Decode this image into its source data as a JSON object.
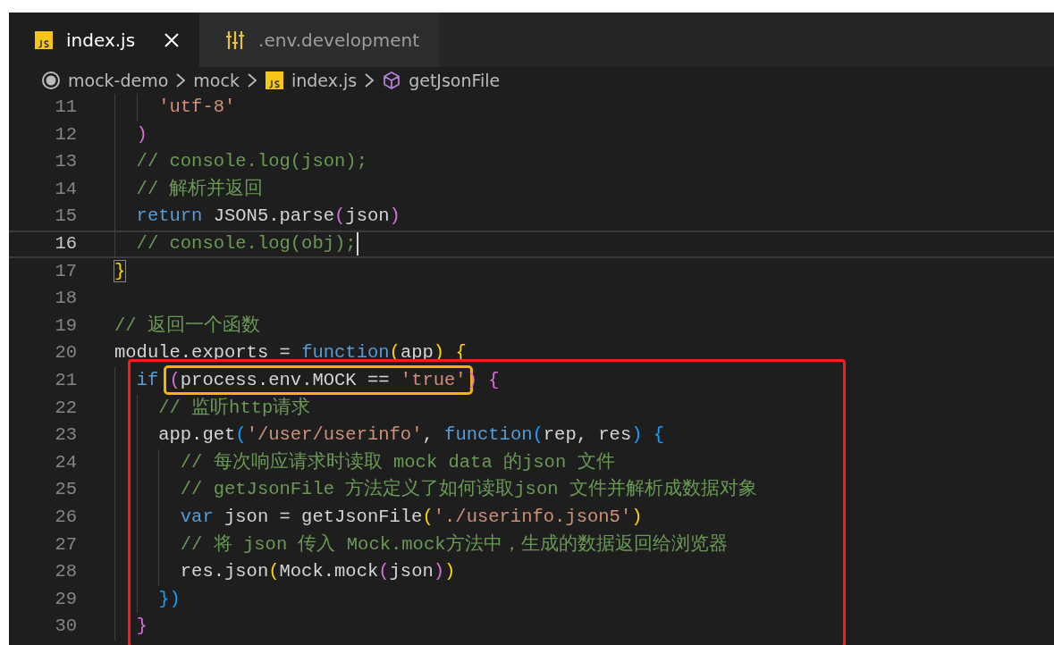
{
  "tabs": [
    {
      "label": "index.js",
      "kind": "script",
      "selected": true,
      "closable": true
    },
    {
      "label": ".env.development",
      "kind": "config",
      "selected": false,
      "closable": false
    }
  ],
  "breadcrumb": [
    {
      "text": "mock-demo",
      "kind": "root"
    },
    {
      "text": "mock",
      "kind": "folder"
    },
    {
      "text": "index.js",
      "kind": "script"
    },
    {
      "text": "getJsonFile",
      "kind": "symbol"
    }
  ],
  "lines": [
    {
      "children": [
        {
          "children": [
            {
              "number": "11",
              "current": false,
              "boxed": false,
              "tokens": [
                {
                  "kind": "string",
                  "text": "'utf-8'"
                }
              ]
            }
          ]
        },
        {
          "number": "12",
          "current": false,
          "boxed": false,
          "tokens": [
            {
              "kind": "bracket",
              "color": "#da70d6",
              "text": ")"
            }
          ]
        },
        {
          "number": "13",
          "current": false,
          "boxed": false,
          "tokens": [
            {
              "kind": "comment",
              "text": "// console.log(json);"
            }
          ]
        },
        {
          "number": "14",
          "current": false,
          "boxed": false,
          "tokens": [
            {
              "kind": "comment",
              "text": "// 解析并返回"
            }
          ]
        },
        {
          "number": "15",
          "current": false,
          "boxed": false,
          "tokens": [
            {
              "kind": "keyword",
              "text": "return"
            },
            {
              "kind": "plain",
              "text": " JSON5.parse"
            },
            {
              "kind": "bracket",
              "color": "#da70d6",
              "text": "("
            },
            {
              "kind": "plain",
              "text": "json"
            },
            {
              "kind": "bracket",
              "color": "#da70d6",
              "text": ")"
            }
          ]
        },
        {
          "number": "16",
          "current": true,
          "boxed": false,
          "tokens": [
            {
              "kind": "comment",
              "text": "// console.log(obj);"
            }
          ]
        }
      ]
    },
    {
      "number": "17",
      "current": false,
      "boxed": false,
      "tokens": [
        {
          "kind": "bracket",
          "color": "#ffd700",
          "matched": true,
          "text": "}"
        }
      ]
    },
    {
      "number": "18",
      "current": false,
      "boxed": false
    },
    {
      "number": "19",
      "current": false,
      "boxed": false,
      "tokens": [
        {
          "kind": "comment",
          "text": "// 返回一个函数"
        }
      ]
    },
    {
      "number": "20",
      "current": false,
      "boxed": false,
      "tokens": [
        {
          "kind": "plain",
          "text": "module.exports = "
        },
        {
          "kind": "keyword",
          "text": "function"
        },
        {
          "kind": "bracket",
          "color": "#ffd700",
          "text": "("
        },
        {
          "kind": "plain",
          "text": "app"
        },
        {
          "kind": "bracket",
          "color": "#ffd700",
          "text": ") "
        },
        {
          "kind": "bracket",
          "color": "#ffd700",
          "text": "{"
        }
      ],
      "children": [
        {
          "number": "21",
          "current": false,
          "boxed": true,
          "tokens": [
            {
              "kind": "keyword",
              "text": "if "
            },
            {
              "kind": "bracket",
              "color": "#da70d6",
              "circled": true,
              "text": "("
            },
            {
              "kind": "plain",
              "circled": true,
              "text": "process.env.MOCK == "
            },
            {
              "kind": "string",
              "circled": true,
              "text": "'true'"
            },
            {
              "kind": "bracket",
              "color": "#da70d6",
              "text": ") "
            },
            {
              "kind": "bracket",
              "color": "#da70d6",
              "text": "{"
            }
          ],
          "children": [
            {
              "number": "22",
              "current": false,
              "boxed": true,
              "tokens": [
                {
                  "kind": "comment",
                  "text": "// 监听http请求"
                }
              ]
            },
            {
              "number": "23",
              "current": false,
              "boxed": true,
              "tokens": [
                {
                  "kind": "plain",
                  "text": "app.get"
                },
                {
                  "kind": "bracket",
                  "color": "#179fff",
                  "text": "("
                },
                {
                  "kind": "string",
                  "text": "'/user/userinfo'"
                },
                {
                  "kind": "plain",
                  "text": ", "
                },
                {
                  "kind": "keyword",
                  "text": "function"
                },
                {
                  "kind": "bracket",
                  "color": "#179fff",
                  "text": "("
                },
                {
                  "kind": "plain",
                  "text": "rep, res"
                },
                {
                  "kind": "bracket",
                  "color": "#179fff",
                  "text": ") "
                },
                {
                  "kind": "bracket",
                  "color": "#179fff",
                  "text": "{"
                }
              ],
              "children": [
                {
                  "number": "24",
                  "current": false,
                  "boxed": true,
                  "tokens": [
                    {
                      "kind": "comment",
                      "text": "// 每次响应请求时读取 mock data 的json 文件"
                    }
                  ]
                },
                {
                  "number": "25",
                  "current": false,
                  "boxed": true,
                  "tokens": [
                    {
                      "kind": "comment",
                      "text": "// getJsonFile 方法定义了如何读取json 文件并解析成数据对象"
                    }
                  ]
                },
                {
                  "number": "26",
                  "current": false,
                  "boxed": true,
                  "tokens": [
                    {
                      "kind": "keyword",
                      "text": "var"
                    },
                    {
                      "kind": "plain",
                      "text": " json = getJsonFile"
                    },
                    {
                      "kind": "bracket",
                      "color": "#ffd700",
                      "text": "("
                    },
                    {
                      "kind": "string",
                      "text": "'./userinfo.json5'"
                    },
                    {
                      "kind": "bracket",
                      "color": "#ffd700",
                      "text": ")"
                    }
                  ]
                },
                {
                  "number": "27",
                  "current": false,
                  "boxed": true,
                  "tokens": [
                    {
                      "kind": "comment",
                      "text": "// 将 json 传入 Mock.mock方法中，生成的数据返回给浏览器"
                    }
                  ]
                },
                {
                  "number": "28",
                  "current": false,
                  "boxed": true,
                  "tokens": [
                    {
                      "kind": "plain",
                      "text": "res.json"
                    },
                    {
                      "kind": "bracket",
                      "color": "#ffd700",
                      "text": "("
                    },
                    {
                      "kind": "plain",
                      "text": "Mock.mock"
                    },
                    {
                      "kind": "bracket",
                      "color": "#da70d6",
                      "text": "("
                    },
                    {
                      "kind": "plain",
                      "text": "json"
                    },
                    {
                      "kind": "bracket",
                      "color": "#da70d6",
                      "text": ")"
                    },
                    {
                      "kind": "bracket",
                      "color": "#ffd700",
                      "text": ")"
                    }
                  ]
                }
              ]
            },
            {
              "number": "29",
              "current": false,
              "boxed": true,
              "tokens": [
                {
                  "kind": "bracket",
                  "color": "#179fff",
                  "text": "}"
                },
                {
                  "kind": "bracket",
                  "color": "#179fff",
                  "text": ")"
                }
              ]
            }
          ]
        },
        {
          "number": "30",
          "current": false,
          "boxed": true,
          "tokens": [
            {
              "kind": "bracket",
              "color": "#da70d6",
              "text": "}"
            }
          ]
        }
      ]
    }
  ]
}
